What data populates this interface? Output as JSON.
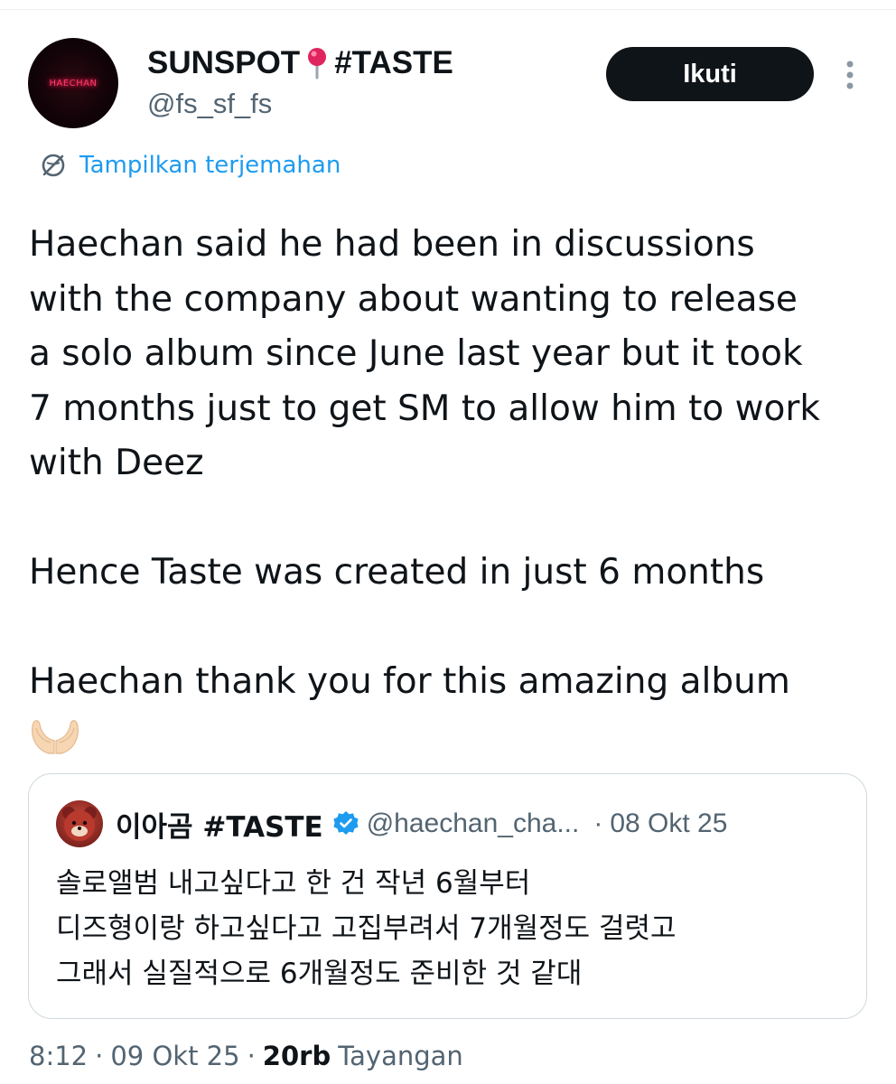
{
  "author": {
    "avatar_text": "HAECHAN",
    "display_name_part1": "SUNSPOT",
    "display_name_part2": "#TASTE",
    "handle": "@fs_sf_fs",
    "follow_label": "Ikuti"
  },
  "translate_label": "Tampilkan terjemahan",
  "tweet": {
    "paragraph1_lines": [
      "Haechan said he had been in discussions",
      "with the company about wanting to release",
      "a solo album since June last year but it took",
      "7 months just to get SM to allow him to work",
      "with Deez"
    ],
    "paragraph2": "Hence Taste was created in just 6 months",
    "paragraph3": "Haechan thank you for this amazing album"
  },
  "quote": {
    "name": "이아곰 #TASTE",
    "handle": "@haechan_cha...",
    "separator": "·",
    "date": "08 Okt 25",
    "lines": [
      "솔로앨범 내고싶다고 한 건 작년 6월부터",
      "디즈형이랑 하고싶다고 고집부려서 7개월정도 걸렷고",
      "그래서 실질적으로 6개월정도 준비한 것 같대"
    ]
  },
  "meta": {
    "time": "8:12",
    "sep": "·",
    "date": "09 Okt 25",
    "views_count": "20rb",
    "views_label": "Tayangan"
  },
  "colors": {
    "link": "#1d9bf0",
    "text": "#0f1419",
    "secondary": "#536471",
    "border": "#cfd9de",
    "verified": "#1d9bf0",
    "pin": "#e0245e"
  }
}
